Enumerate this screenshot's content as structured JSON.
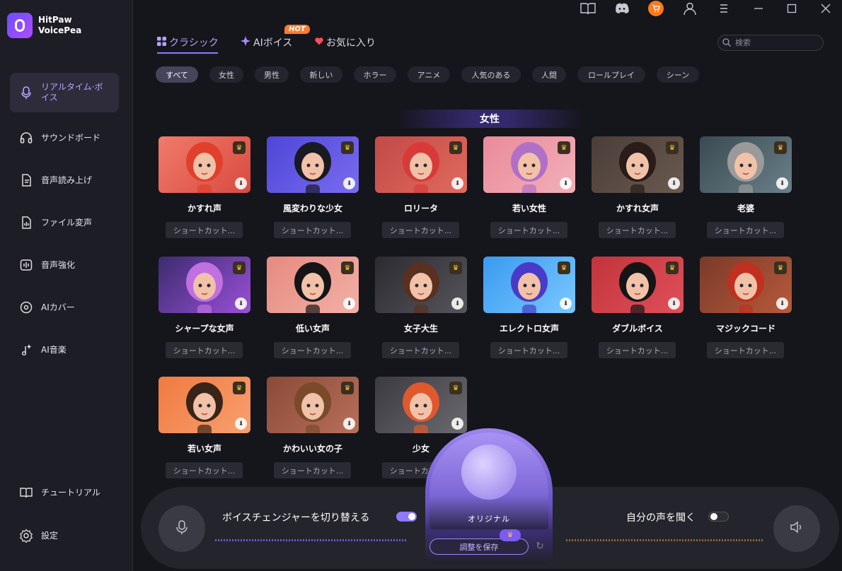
{
  "app": {
    "name_line1": "HitPaw",
    "name_line2": "VoicePea"
  },
  "sidebar": {
    "items": [
      {
        "label": "リアルタイム·ボイス",
        "icon": "mic-icon",
        "active": true
      },
      {
        "label": "サウンドボード",
        "icon": "headphones-icon"
      },
      {
        "label": "音声読み上げ",
        "icon": "text-to-speech-icon"
      },
      {
        "label": "ファイル変声",
        "icon": "audio-file-icon"
      },
      {
        "label": "音声強化",
        "icon": "enhance-icon"
      },
      {
        "label": "AIカバー",
        "icon": "disc-icon"
      },
      {
        "label": "AI音楽",
        "icon": "music-sparkle-icon"
      },
      {
        "label": "チュートリアル",
        "icon": "book-icon"
      },
      {
        "label": "設定",
        "icon": "gear-icon"
      }
    ]
  },
  "tabs": [
    {
      "label": "クラシック",
      "icon": "grid-icon",
      "active": true
    },
    {
      "label": "AIボイス",
      "icon": "sparkle-icon",
      "badge": "HOT"
    },
    {
      "label": "お気に入り",
      "icon": "heart-icon"
    }
  ],
  "search": {
    "placeholder": "検索"
  },
  "filters": [
    "すべて",
    "女性",
    "男性",
    "新しい",
    "ホラー",
    "アニメ",
    "人気のある",
    "人間",
    "ロールプレイ",
    "シーン"
  ],
  "section_title": "女性",
  "voices": [
    {
      "name": "かすれ声",
      "shortcut": "ショートカット..."
    },
    {
      "name": "風変わりな少女",
      "shortcut": "ショートカット..."
    },
    {
      "name": "ロリータ",
      "shortcut": "ショートカット..."
    },
    {
      "name": "若い女性",
      "shortcut": "ショートカット..."
    },
    {
      "name": "かすれ女声",
      "shortcut": "ショートカット..."
    },
    {
      "name": "老婆",
      "shortcut": "ショートカット..."
    },
    {
      "name": "シャープな女声",
      "shortcut": "ショートカット..."
    },
    {
      "name": "低い女声",
      "shortcut": "ショートカット..."
    },
    {
      "name": "女子大生",
      "shortcut": "ショートカット..."
    },
    {
      "name": "エレクトロ女声",
      "shortcut": "ショートカット..."
    },
    {
      "name": "ダブルボイス",
      "shortcut": "ショートカット..."
    },
    {
      "name": "マジックコード",
      "shortcut": "ショートカット..."
    },
    {
      "name": "若い女声",
      "shortcut": "ショートカット..."
    },
    {
      "name": "かわいい女の子",
      "shortcut": "ショートカット..."
    },
    {
      "name": "少女",
      "shortcut": "ショートカット..."
    }
  ],
  "bottom": {
    "voice_changer_label": "ボイスチェンジャーを切り替える",
    "voice_changer_on": true,
    "hear_self_label": "自分の声を聞く",
    "hear_self_on": false,
    "current_voice": "オリジナル",
    "save_label": "調整を保存"
  },
  "colors": {
    "accent": "#8f79ff",
    "hot": "#ff7a2c",
    "crown": "#ffc233"
  }
}
